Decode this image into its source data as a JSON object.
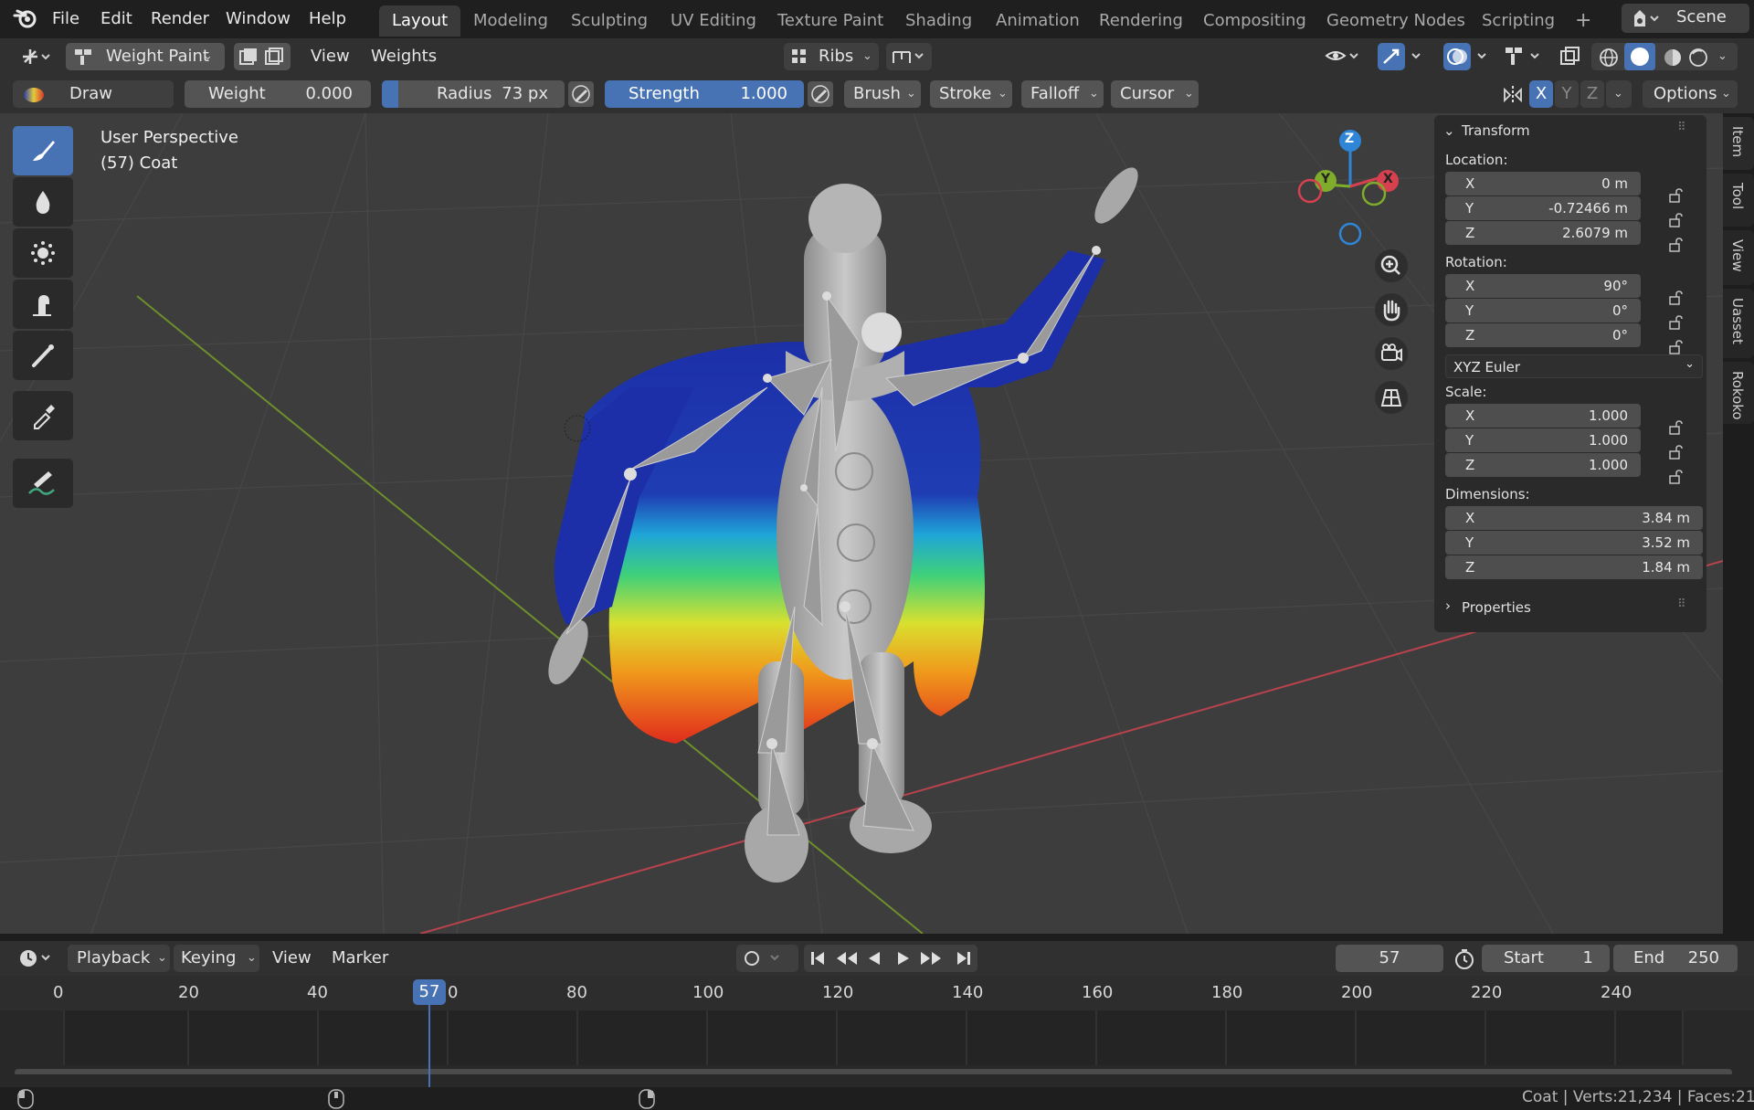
{
  "menu": {
    "items": [
      "File",
      "Edit",
      "Render",
      "Window",
      "Help"
    ]
  },
  "workspaces": {
    "tabs": [
      "Layout",
      "Modeling",
      "Sculpting",
      "UV Editing",
      "Texture Paint",
      "Shading",
      "Animation",
      "Rendering",
      "Compositing",
      "Geometry Nodes",
      "Scripting"
    ],
    "active": "Layout",
    "add_label": "+"
  },
  "scene": {
    "name": "Scene"
  },
  "header1": {
    "mode": "Weight Paint",
    "view": "View",
    "weights": "Weights",
    "group": "Ribs"
  },
  "header2": {
    "brush_name": "Draw",
    "weight_label": "Weight",
    "weight_value": "0.000",
    "radius_label": "Radius",
    "radius_value": "73 px",
    "strength_label": "Strength",
    "strength_value": "1.000",
    "brush": "Brush",
    "stroke": "Stroke",
    "falloff": "Falloff",
    "cursor": "Cursor",
    "mirror_x": "X",
    "mirror_y": "Y",
    "mirror_z": "Z",
    "options": "Options"
  },
  "viewport": {
    "perspective": "User Perspective",
    "object": "(57) Coat",
    "gizmo": {
      "x": "X",
      "y": "Y",
      "z": "Z"
    }
  },
  "npanel": {
    "transform_title": "Transform",
    "location_label": "Location:",
    "location": [
      {
        "axis": "X",
        "value": "0 m"
      },
      {
        "axis": "Y",
        "value": "-0.72466 m"
      },
      {
        "axis": "Z",
        "value": "2.6079 m"
      }
    ],
    "rotation_label": "Rotation:",
    "rotation": [
      {
        "axis": "X",
        "value": "90°"
      },
      {
        "axis": "Y",
        "value": "0°"
      },
      {
        "axis": "Z",
        "value": "0°"
      }
    ],
    "rotation_mode": "XYZ Euler",
    "scale_label": "Scale:",
    "scale": [
      {
        "axis": "X",
        "value": "1.000"
      },
      {
        "axis": "Y",
        "value": "1.000"
      },
      {
        "axis": "Z",
        "value": "1.000"
      }
    ],
    "dimensions_label": "Dimensions:",
    "dimensions": [
      {
        "axis": "X",
        "value": "3.84 m"
      },
      {
        "axis": "Y",
        "value": "3.52 m"
      },
      {
        "axis": "Z",
        "value": "1.84 m"
      }
    ],
    "properties_title": "Properties",
    "side_tabs": [
      "Item",
      "Tool",
      "View",
      "Uasset",
      "Rokoko"
    ]
  },
  "timeline": {
    "playback": "Playback",
    "keying": "Keying",
    "view": "View",
    "marker": "Marker",
    "current_frame": "57",
    "start_label": "Start",
    "start_value": "1",
    "end_label": "End",
    "end_value": "250",
    "ticks": [
      "0",
      "20",
      "40",
      "0",
      "80",
      "100",
      "120",
      "140",
      "160",
      "180",
      "200",
      "220",
      "240"
    ],
    "playhead": "57"
  },
  "status": {
    "text": "Coat | Verts:21,234 | Faces:21"
  },
  "colors": {
    "accent": "#4772b3",
    "x_axis": "#d6404f",
    "y_axis": "#7fad2b",
    "z_axis": "#2f86d6"
  }
}
